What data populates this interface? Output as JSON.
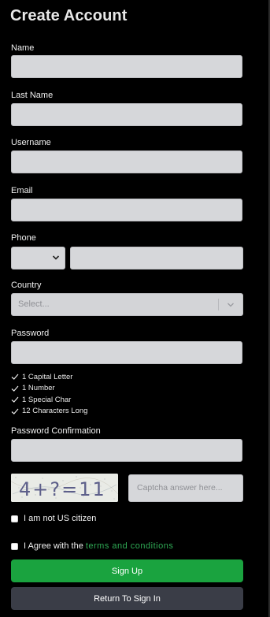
{
  "form": {
    "title": "Create Account",
    "name_label": "Name",
    "last_name_label": "Last Name",
    "username_label": "Username",
    "email_label": "Email",
    "phone_label": "Phone",
    "country_label": "Country",
    "country_placeholder": "Select...",
    "password_label": "Password",
    "password_requirements": [
      "1 Capital Letter",
      "1 Number",
      "1 Special Char",
      "12 Characters Long"
    ],
    "password_confirmation_label": "Password Confirmation",
    "captcha_text": "4+?=11",
    "captcha_placeholder": "Captcha answer here...",
    "not_us_citizen_label": "I am not US citizen",
    "agree_label": "I Agree with the",
    "terms_link": "terms and conditions",
    "signup_button": "Sign Up",
    "return_button": "Return To Sign In"
  },
  "colors": {
    "background": "#000000",
    "input": "#d6d7da",
    "primary": "#1aa33f",
    "secondary": "#3a3d47",
    "link": "#2faa55"
  },
  "icons": {
    "dropdown": "chevron-down-icon",
    "requirement": "check-icon"
  }
}
